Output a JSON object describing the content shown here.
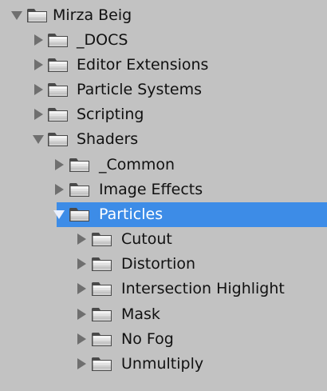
{
  "tree": {
    "rows": [
      {
        "label": "Mirza Beig",
        "state": "open",
        "depth": 0
      },
      {
        "label": "_DOCS",
        "state": "closed",
        "depth": 1
      },
      {
        "label": "Editor Extensions",
        "state": "closed",
        "depth": 1
      },
      {
        "label": "Particle Systems",
        "state": "closed",
        "depth": 1
      },
      {
        "label": "Scripting",
        "state": "closed",
        "depth": 1
      },
      {
        "label": "Shaders",
        "state": "open",
        "depth": 1
      },
      {
        "label": "_Common",
        "state": "closed",
        "depth": 2
      },
      {
        "label": "Image Effects",
        "state": "closed",
        "depth": 2
      },
      {
        "label": "Particles",
        "state": "open",
        "depth": 2,
        "selected": true
      },
      {
        "label": "Cutout",
        "state": "closed",
        "depth": 3
      },
      {
        "label": "Distortion",
        "state": "closed",
        "depth": 3
      },
      {
        "label": "Intersection Highlight",
        "state": "closed",
        "depth": 3
      },
      {
        "label": "Mask",
        "state": "closed",
        "depth": 3
      },
      {
        "label": "No Fog",
        "state": "closed",
        "depth": 3
      },
      {
        "label": "Unmultiply",
        "state": "closed",
        "depth": 3
      }
    ]
  },
  "icons": {
    "folder": "folder-icon",
    "expand_closed": "triangle-right-icon",
    "expand_open": "triangle-down-icon"
  },
  "colors": {
    "background": "#c2c2c2",
    "selection": "#3d8ce7",
    "arrow": "#6f6f6f",
    "text": "#111111",
    "selected_text": "#ffffff"
  }
}
